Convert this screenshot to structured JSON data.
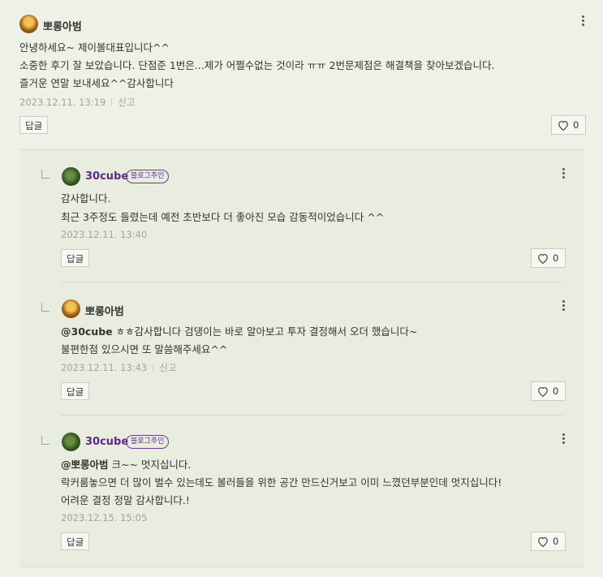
{
  "comments": [
    {
      "author": "뽀롱아범",
      "lines": [
        "안녕하세요~ 제이볼대표입니다^^",
        "소중한 후기 잘 보았습니다. 단점준 1번은...제가 어쩔수없는 것이라 ㅠㅠ 2번문제점은 해결책을 찾아보겠습니다.",
        "즐거운 연말 보내세요^^감사합니다"
      ],
      "date": "2023.12.11. 13:19",
      "report": "신고",
      "reply_label": "답글",
      "likes": "0"
    }
  ],
  "replies": [
    {
      "author": "30cube",
      "badge": "블로그주인",
      "lines": [
        "감사합니다.",
        "최근 3주정도 들렸는데 예전 초반보다 더 좋아진 모습 감동적이었습니다 ^^"
      ],
      "date": "2023.12.11. 13:40",
      "reply_label": "답글",
      "likes": "0"
    },
    {
      "author": "뽀롱아범",
      "mention": "@30cube",
      "lines": [
        " ㅎㅎ감사합니다 검댕이는 바로 알아보고 투자 결정해서 오더 했습니다~",
        "불편한점 있으시면 또 말씀해주세요^^"
      ],
      "date": "2023.12.11. 13:43",
      "report": "신고",
      "reply_label": "답글",
      "likes": "0"
    },
    {
      "author": "30cube",
      "badge": "블로그주인",
      "mention": "@뽀롱아범",
      "lines": [
        " 크~~ 멋지십니다.",
        "락커룸놓으면 더 많이 벌수 있는데도 볼러들을 위한 공간 만드신거보고 이미 느꼈던부분인데 멋지십니다!",
        "어려운 결정 정말 감사합니다.!"
      ],
      "date": "2023.12.15. 15:05",
      "reply_label": "답글",
      "likes": "0"
    }
  ]
}
